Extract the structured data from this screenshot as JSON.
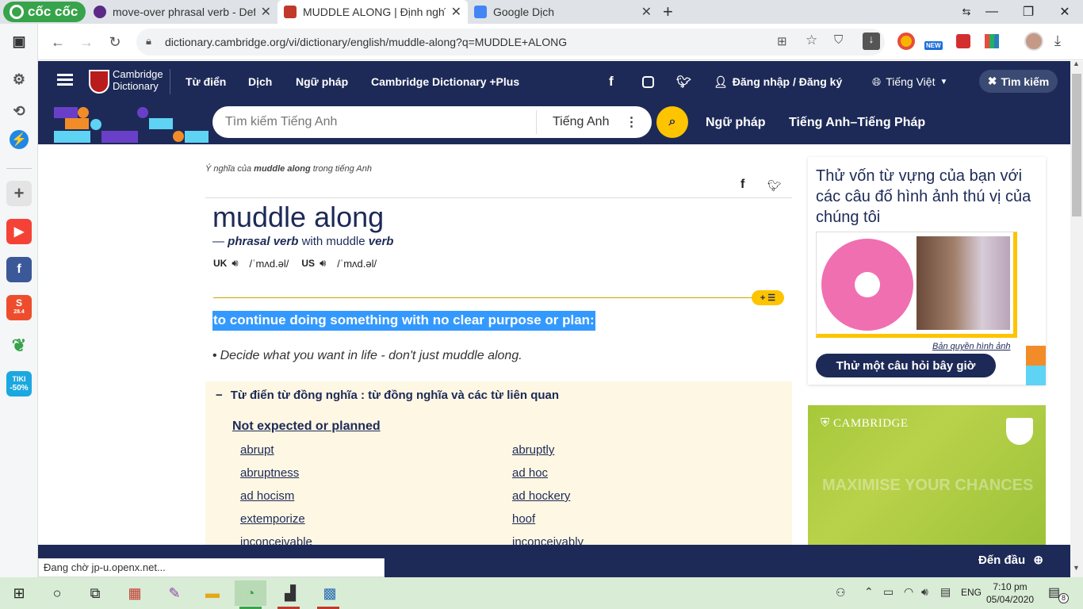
{
  "browser": {
    "tabs": [
      {
        "title": "move-over phrasal verb - Def",
        "fav_color": "#5b2a86"
      },
      {
        "title": "MUDDLE ALONG | Định nghĩa",
        "fav_color": "#c0392b"
      },
      {
        "title": "Google Dịch",
        "fav_color": "#4285f4"
      }
    ],
    "logo": "cốc cốc",
    "url": "dictionary.cambridge.org/vi/dictionary/english/muddle-along?q=MUDDLE+ALONG",
    "new_badge": "NEW",
    "status_text": "Đang chờ jp-u.openx.net..."
  },
  "sidebar_labels": {
    "tiki": "TIKI",
    "tiki_discount": "-50%",
    "shopee_date": "28.4"
  },
  "header": {
    "logo_line1": "Cambridge",
    "logo_line2": "Dictionary",
    "nav": [
      "Từ điển",
      "Dịch",
      "Ngữ pháp",
      "Cambridge Dictionary +Plus"
    ],
    "login": "Đăng nhập / Đăng ký",
    "language": "Tiếng Việt",
    "search_button": "Tìm kiếm"
  },
  "subheader": {
    "search_placeholder": "Tìm kiếm Tiếng Anh",
    "search_lang": "Tiếng Anh",
    "links": [
      "Ngữ pháp",
      "Tiếng Anh–Tiếng Pháp"
    ]
  },
  "entry": {
    "breadcrumb_prefix": "Ý nghĩa của",
    "breadcrumb_word": "muddle along",
    "breadcrumb_suffix": "trong tiếng Anh",
    "headword": "muddle along",
    "dash": "—",
    "pos": "phrasal verb",
    "with": "with muddle",
    "with_pos": "verb",
    "uk_label": "UK",
    "uk_ipa": "/ˈmʌd.əl/",
    "us_label": "US",
    "us_ipa": "/ˈmʌd.əl/",
    "definition": "to continue doing something with no clear purpose or plan:",
    "example": "Decide what you want in life - don't just muddle along.",
    "thesaurus_title": "Từ điển từ đồng nghĩa : từ đồng nghĩa và các từ liên quan",
    "thesaurus_group": "Not expected or planned",
    "synonyms_left": [
      "abrupt",
      "abruptness",
      "ad hocism",
      "extemporize",
      "inconceivable"
    ],
    "synonyms_right": [
      "abruptly",
      "ad hoc",
      "ad hockery",
      "hoof",
      "inconceivably"
    ]
  },
  "quiz": {
    "title": "Thử vốn từ vựng của bạn với các câu đố hình ảnh thú vị của chúng tôi",
    "copyright": "Bản quyền hình ảnh",
    "button": "Thử một câu hỏi bây giờ"
  },
  "ad": {
    "brand": "CAMBRIDGE",
    "faded_text": "MAXIMISE YOUR CHANCES"
  },
  "bottom": {
    "back_to_top": "Đến đầu"
  },
  "taskbar": {
    "lang": "ENG",
    "time": "7:10 pm",
    "date": "05/04/2020",
    "notif_count": "8"
  },
  "colors": {
    "cd_navy": "#1d2a57",
    "cd_yellow": "#fec400",
    "highlight": "#3399ff",
    "thesaurus_bg": "#fef7e4"
  }
}
